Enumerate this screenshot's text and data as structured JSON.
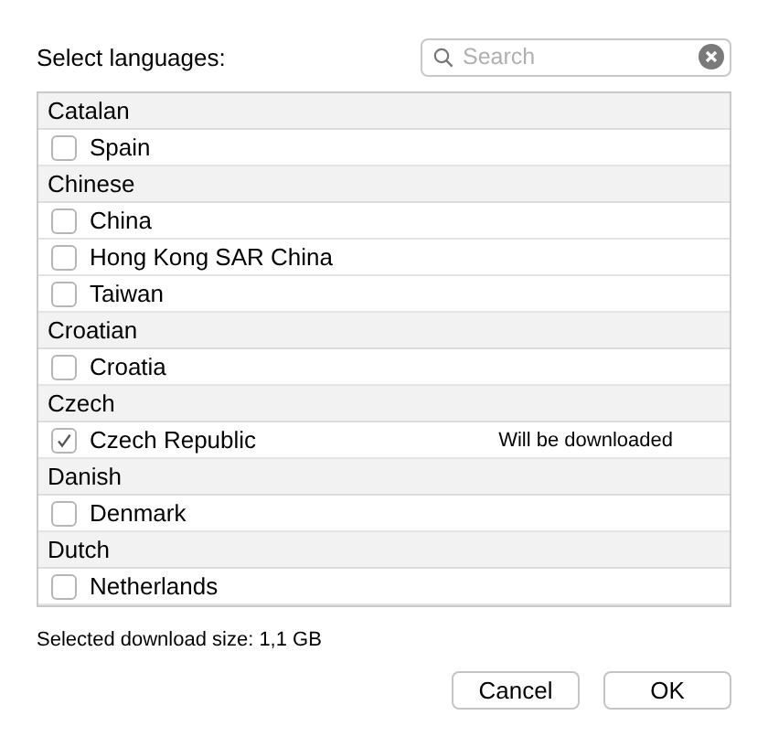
{
  "title": "Select languages:",
  "search": {
    "placeholder": "Search"
  },
  "groups": [
    {
      "name": "Catalan",
      "regions": [
        {
          "name": "Spain",
          "checked": false
        }
      ]
    },
    {
      "name": "Chinese",
      "regions": [
        {
          "name": "China",
          "checked": false
        },
        {
          "name": "Hong Kong SAR China",
          "checked": false
        },
        {
          "name": "Taiwan",
          "checked": false
        }
      ]
    },
    {
      "name": "Croatian",
      "regions": [
        {
          "name": "Croatia",
          "checked": false
        }
      ]
    },
    {
      "name": "Czech",
      "regions": [
        {
          "name": "Czech Republic",
          "checked": true,
          "status": "Will be downloaded"
        }
      ]
    },
    {
      "name": "Danish",
      "regions": [
        {
          "name": "Denmark",
          "checked": false
        }
      ]
    },
    {
      "name": "Dutch",
      "regions": [
        {
          "name": "Netherlands",
          "checked": false
        }
      ]
    }
  ],
  "download_size": "Selected download size: 1,1 GB",
  "buttons": [
    "Cancel",
    "OK"
  ]
}
